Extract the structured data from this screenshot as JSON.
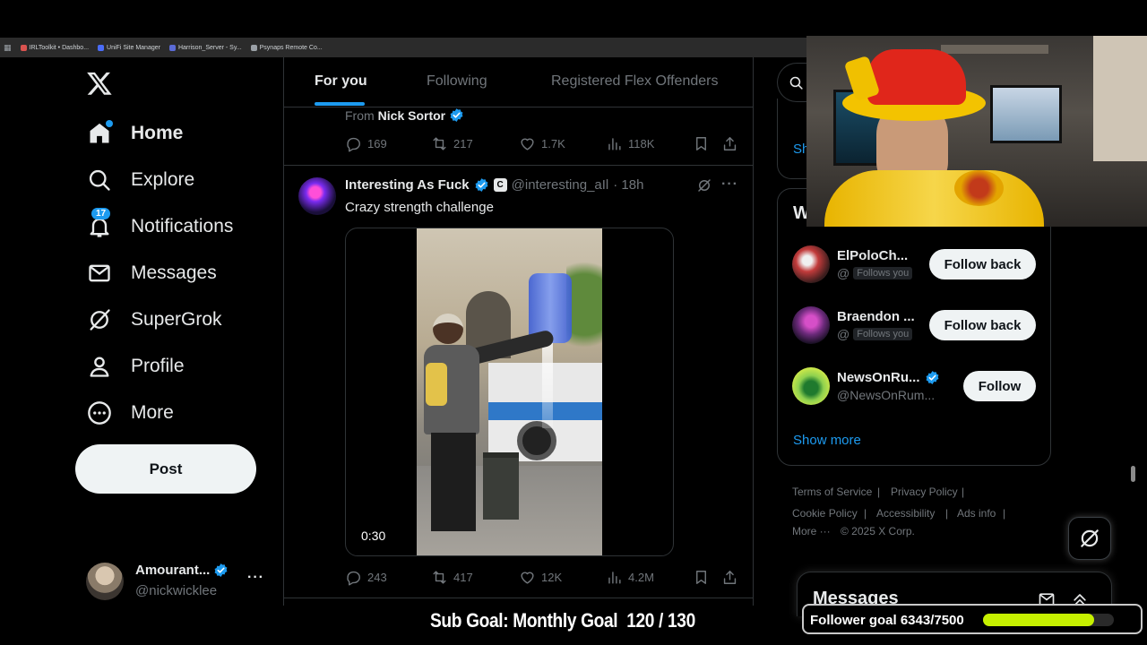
{
  "bookmarks": [
    {
      "label": "IRLToolkit • Dashbo...",
      "color": "#d9534f"
    },
    {
      "label": "UniFi Site Manager",
      "color": "#4a6cf7"
    },
    {
      "label": "Harrison_Server - Sy...",
      "color": "#5b6bd6"
    },
    {
      "label": "Psynaps Remote Co...",
      "color": "#9aa0a6"
    }
  ],
  "nav": {
    "home": "Home",
    "explore": "Explore",
    "notifications": "Notifications",
    "notifications_badge": "17",
    "messages": "Messages",
    "supergrok": "SuperGrok",
    "profile": "Profile",
    "more": "More",
    "post_label": "Post"
  },
  "account": {
    "name": "Amourant...",
    "handle": "@nickwicklee"
  },
  "tabs": [
    "For you",
    "Following",
    "Registered Flex Offenders"
  ],
  "prev_tweet": {
    "from_label": "From",
    "from_name": "Nick Sortor",
    "replies": "169",
    "reposts": "217",
    "likes": "1.7K",
    "views": "118K"
  },
  "tweet": {
    "author": "Interesting As Fuck",
    "handle": "@interesting_aIl",
    "time": "· 18h",
    "text": "Crazy strength challenge",
    "video_duration": "0:30",
    "replies": "243",
    "reposts": "417",
    "likes": "12K",
    "views": "4.2M"
  },
  "who_to_follow": {
    "title_fragment": "W",
    "items": [
      {
        "name": "ElPoloCh...",
        "handle": "@",
        "badge": "Follows you",
        "button": "Follow back"
      },
      {
        "name": "Braendon ...",
        "handle": "@",
        "badge": "Follows you",
        "button": "Follow back"
      },
      {
        "name": "NewsOnRu...",
        "handle": "@NewsOnRum...",
        "badge": "",
        "button": "Follow"
      }
    ],
    "show_more": "Show more"
  },
  "trend_fragment": "Sh",
  "footer": {
    "terms": "Terms of Service",
    "privacy": "Privacy Policy",
    "cookie": "Cookie Policy",
    "accessibility": "Accessibility",
    "ads": "Ads info",
    "more": "More ···",
    "copyright": "© 2025 X Corp."
  },
  "messages_drawer": {
    "title": "Messages"
  },
  "overlay": {
    "sub_goal": "Sub Goal: Monthly Goal  120 / 130",
    "follower_goal": "Follower goal 6343/7500",
    "follower_progress": 0.846
  },
  "colors": {
    "accent": "#1d9bf0",
    "progress": "#c6f000",
    "background": "#000000"
  }
}
